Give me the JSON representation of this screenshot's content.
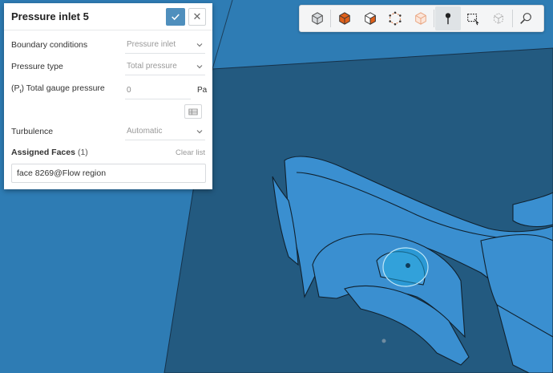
{
  "panel": {
    "title": "Pressure inlet 5",
    "confirm_icon": "check-icon",
    "close_icon": "close-icon",
    "close_glyph": "✕",
    "boundary_conditions": {
      "label": "Boundary conditions",
      "value": "Pressure inlet"
    },
    "pressure_type": {
      "label": "Pressure type",
      "value": "Total pressure"
    },
    "total_gauge_pressure": {
      "label_prefix": "(P",
      "label_sub": "t",
      "label_suffix": ") Total gauge pressure",
      "value": "0",
      "unit": "Pa"
    },
    "turbulence": {
      "label": "Turbulence",
      "value": "Automatic"
    },
    "assigned_faces": {
      "label": "Assigned Faces",
      "count": "(1)",
      "clear_label": "Clear list",
      "items": [
        "face 8269@Flow region"
      ]
    }
  },
  "toolbar": {
    "buttons": [
      {
        "icon": "cube-default-icon"
      },
      {
        "icon": "cube-solid-orange-icon"
      },
      {
        "icon": "cube-split-icon"
      },
      {
        "icon": "cube-points-icon"
      },
      {
        "icon": "cube-transparent-icon"
      },
      {
        "icon": "point-select-icon",
        "active": true
      },
      {
        "icon": "box-select-icon"
      },
      {
        "icon": "box-select-faded-icon"
      },
      {
        "icon": "search-face-icon"
      }
    ]
  },
  "colors": {
    "viewport_background": "#2e7cb4",
    "floor": "#235a80",
    "geometry": "#3a8fd0",
    "highlight": "#1fa3d8",
    "accent": "#4f8fbd",
    "orange": "#e0601a"
  }
}
